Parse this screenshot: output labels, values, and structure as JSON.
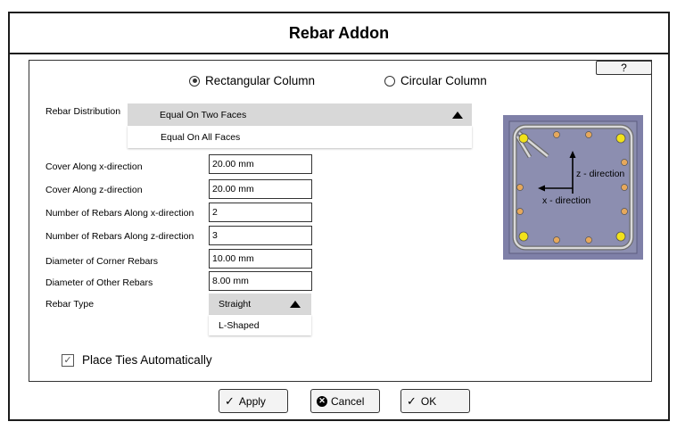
{
  "dialog": {
    "title": "Rebar Addon",
    "help_label": "?"
  },
  "column_type": {
    "options": [
      {
        "label": "Rectangular Column",
        "selected": true
      },
      {
        "label": "Circular Column",
        "selected": false
      }
    ]
  },
  "distribution": {
    "label": "Rebar Distribution",
    "selected": "Equal On Two Faces",
    "options": [
      "Equal On All Faces"
    ]
  },
  "fields": [
    {
      "label": "Cover Along x-direction",
      "value": "20.00 mm"
    },
    {
      "label": "Cover Along z-direction",
      "value": "20.00 mm"
    },
    {
      "label": "Number of Rebars Along x-direction",
      "value": "2"
    },
    {
      "label": "Number of Rebars Along z-direction",
      "value": "3"
    },
    {
      "label": "Diameter of Corner Rebars",
      "value": "10.00 mm"
    },
    {
      "label": "Diameter of Other Rebars",
      "value": "8.00 mm"
    }
  ],
  "rebar_type": {
    "label": "Rebar Type",
    "selected": "Straight",
    "options": [
      "L-Shaped"
    ]
  },
  "ties": {
    "label": "Place Ties Automatically",
    "checked": true
  },
  "diagram": {
    "z_label": "z - direction",
    "x_label": "x - direction"
  },
  "buttons": {
    "apply": "Apply",
    "cancel": "Cancel",
    "ok": "OK"
  }
}
